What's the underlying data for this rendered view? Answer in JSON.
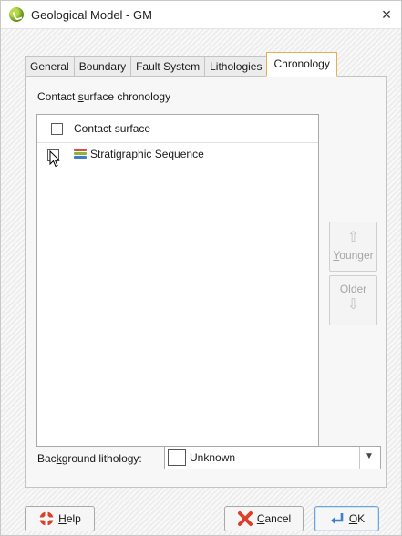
{
  "window": {
    "title": "Geological Model - GM",
    "close_label": "×"
  },
  "tabs": [
    {
      "label": "General",
      "active": false
    },
    {
      "label": "Boundary",
      "active": false
    },
    {
      "label": "Fault System",
      "active": false
    },
    {
      "label": "Lithologies",
      "active": false
    },
    {
      "label": "Chronology",
      "active": true
    }
  ],
  "chronology": {
    "group_label_pre": "Contact ",
    "group_label_u": "s",
    "group_label_post": "urface chronology",
    "list": {
      "header": "Contact surface",
      "items": [
        {
          "label": "Stratigraphic Sequence",
          "checked": false
        }
      ]
    },
    "younger_button": {
      "pre": "",
      "u": "Y",
      "post": "ounger",
      "icon": "arrow-up-icon",
      "enabled": false
    },
    "older_button": {
      "pre": "Ol",
      "u": "d",
      "post": "er",
      "icon": "arrow-down-icon",
      "enabled": false
    },
    "background_lithology": {
      "label_pre": "Bac",
      "label_u": "k",
      "label_post": "ground lithology:",
      "value": "Unknown",
      "swatch_color": "#ffffff"
    }
  },
  "buttons": {
    "help": {
      "u": "H",
      "post": "elp",
      "icon": "help-lifebuoy-icon"
    },
    "cancel": {
      "u": "C",
      "post": "ancel",
      "icon": "cancel-x-icon"
    },
    "ok": {
      "u": "O",
      "post": "K",
      "icon": "ok-arrow-icon"
    }
  },
  "colors": {
    "active_tab_border": "#e8b04c",
    "ok_button_border": "#6fa3d6",
    "cancel_icon": "#d9412b",
    "help_icon": "#d9412b",
    "ok_icon": "#3a7fd0"
  }
}
